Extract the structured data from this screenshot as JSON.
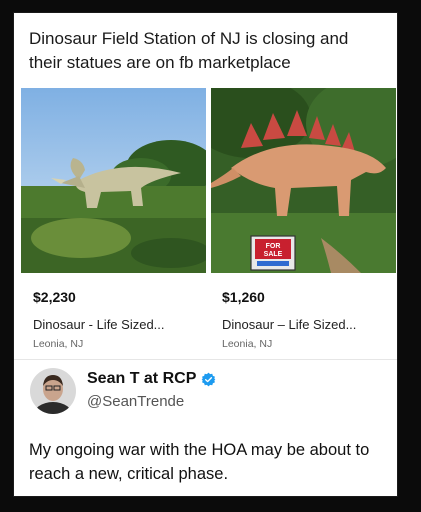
{
  "post": {
    "caption": "Dinosaur Field Station of NJ is closing and their statues are on fb marketplace"
  },
  "listings": [
    {
      "price": "$2,230",
      "title": "Dinosaur - Life Sized...",
      "location": "Leonia, NJ"
    },
    {
      "price": "$1,260",
      "title": "Dinosaur – Life Sized...",
      "location": "Leonia, NJ"
    }
  ],
  "sign": {
    "line1": "FOR",
    "line2": "SALE"
  },
  "tweet": {
    "author_name": "Sean T at RCP",
    "handle": "@SeanTrende",
    "text": "My ongoing war with the HOA may be about to reach a new, critical phase."
  },
  "colors": {
    "verified_badge": "#1d9bf0",
    "sign_red": "#c8202f"
  }
}
